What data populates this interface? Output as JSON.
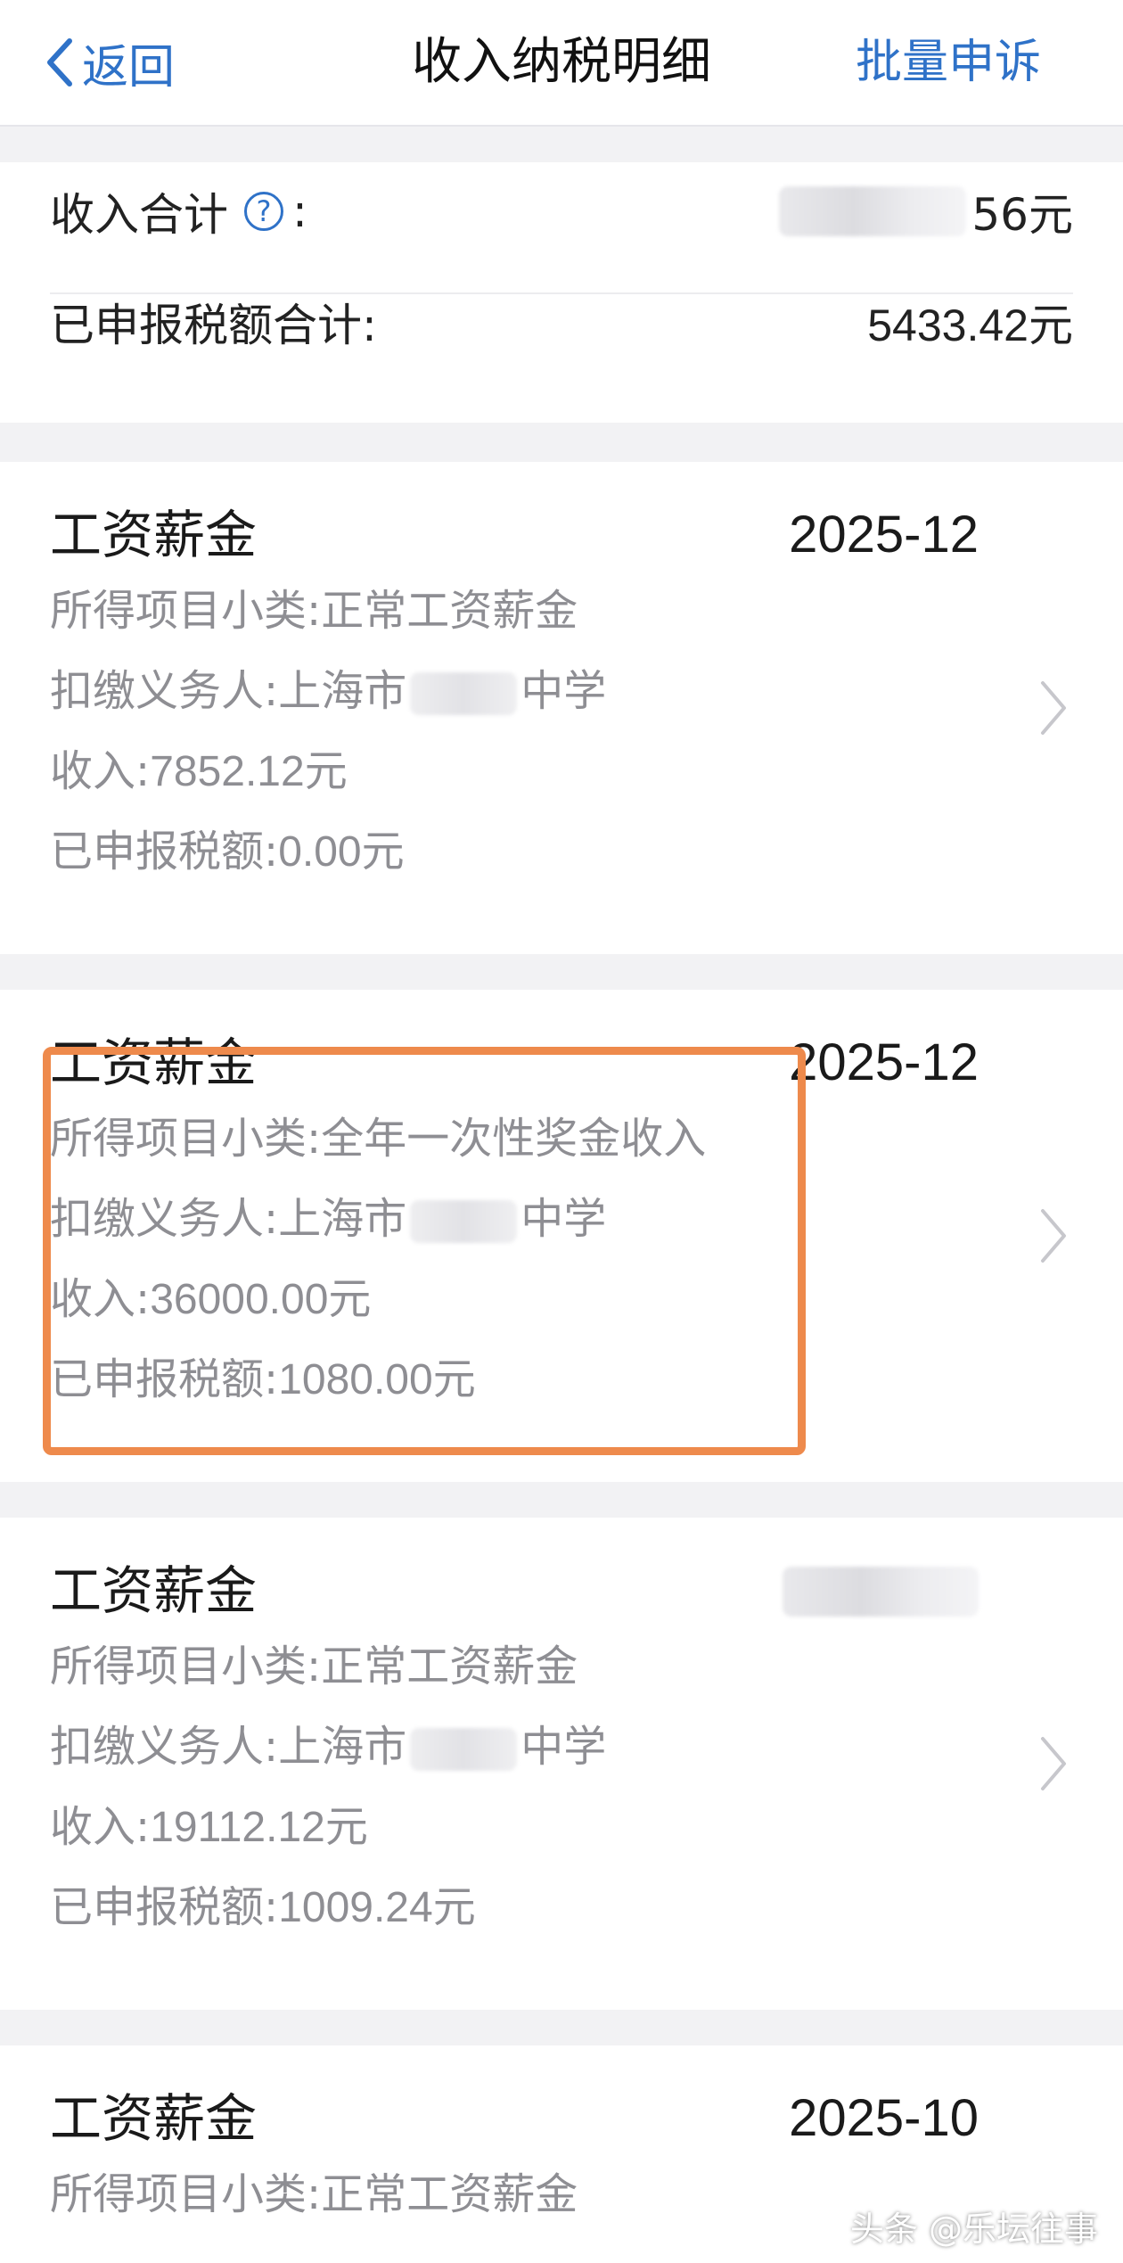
{
  "nav": {
    "back_label": "返回",
    "title": "收入纳税明细",
    "batch_label": "批量申诉"
  },
  "summary": {
    "income_total_label": "收入合计",
    "help_symbol": "?",
    "colon": ":",
    "income_total_visible": "56元",
    "tax_total_label": "已申报税额合计:",
    "tax_total_value": "5433.42元"
  },
  "records": [
    {
      "title": "工资薪金",
      "date": "2025-12",
      "subcategory_label": "所得项目小类:",
      "subcategory": "正常工资薪金",
      "withholder_label": "扣缴义务人:",
      "withholder_prefix": "上海市",
      "withholder_suffix": "中学",
      "income_label": "收入:",
      "income": "7852.12元",
      "tax_label": "已申报税额:",
      "tax": "0.00元"
    },
    {
      "title": "工资薪金",
      "date": "2025-12",
      "subcategory_label": "所得项目小类:",
      "subcategory": "全年一次性奖金收入",
      "withholder_label": "扣缴义务人:",
      "withholder_prefix": "上海市",
      "withholder_suffix": "中学",
      "income_label": "收入:",
      "income": "36000.00元",
      "tax_label": "已申报税额:",
      "tax": "1080.00元"
    },
    {
      "title": "工资薪金",
      "date": "",
      "subcategory_label": "所得项目小类:",
      "subcategory": "正常工资薪金",
      "withholder_label": "扣缴义务人:",
      "withholder_prefix": "上海市",
      "withholder_suffix": "中学",
      "income_label": "收入:",
      "income": "19112.12元",
      "tax_label": "已申报税额:",
      "tax": "1009.24元"
    },
    {
      "title": "工资薪金",
      "date": "2025-10",
      "subcategory_label": "所得项目小类:",
      "subcategory": "正常工资薪金"
    }
  ],
  "watermark": "头条 @乐坛往事",
  "colors": {
    "accent": "#2f72c8",
    "highlight": "#ee8a4c",
    "secondary_text": "#8e8e93"
  }
}
